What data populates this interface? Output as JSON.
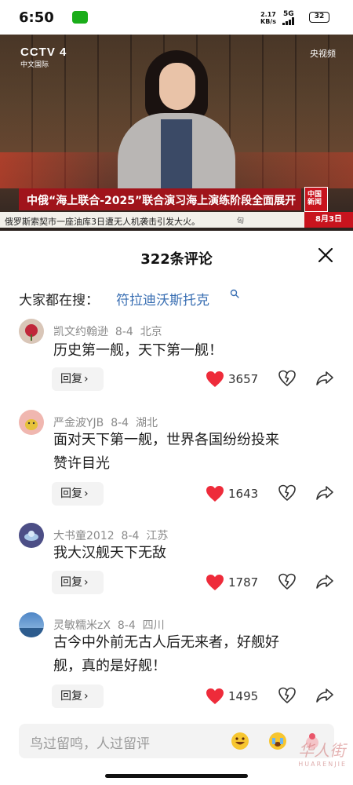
{
  "status_bar": {
    "time": "6:50",
    "net_speed_value": "2.17",
    "net_speed_unit": "KB/s",
    "network": "5G",
    "battery": "32"
  },
  "video": {
    "channel_logo": "CCTV 4",
    "channel_sub": "中文国际",
    "yangshi_label": "央视频",
    "headline": "中俄“海上联合-2025”联合演习海上演练阶段全面展开",
    "headline_tag": "中国新闻",
    "ticker_text": "俄罗斯索契市一座油库3日遭无人机袭击引发大火。",
    "ticker_tail": "匈",
    "date_label": "8月3日"
  },
  "sheet": {
    "title": "322条评论",
    "hot_search_label": "大家都在搜：",
    "hot_search_term": "符拉迪沃斯托克"
  },
  "comments": [
    {
      "user": "凯文约翰逊",
      "date": "8-4",
      "location": "北京",
      "lines": [
        "历史第一舰，天下第一舰！"
      ],
      "likes": "3657",
      "reply_label": "回复"
    },
    {
      "user": "严金波YJB",
      "date": "8-4",
      "location": "湖北",
      "lines": [
        "面对天下第一舰，世界各国纷纷投来",
        "赞许目光"
      ],
      "likes": "1643",
      "reply_label": "回复"
    },
    {
      "user": "大书童2012",
      "date": "8-4",
      "location": "江苏",
      "lines": [
        "我大汉舰天下无敌"
      ],
      "likes": "1787",
      "reply_label": "回复"
    },
    {
      "user": "灵敏糯米zX",
      "date": "8-4",
      "location": "四川",
      "lines": [
        "古今中外前无古人后无来者，好舰好",
        "舰，真的是好舰！"
      ],
      "likes": "1495",
      "reply_label": "回复"
    }
  ],
  "input": {
    "placeholder": "鸟过留鸣，人过留评"
  },
  "watermark": {
    "text": "华人街",
    "sub": "HUARENJIE"
  },
  "colors": {
    "heart": "#ee2b3a",
    "link": "#3a6fb3",
    "headline_bg": "#a0141b"
  },
  "icons": [
    "wechat-icon",
    "signal-icon",
    "search-icon",
    "close-icon",
    "heart-icon",
    "dislike-icon",
    "share-icon",
    "emoji-icon"
  ]
}
